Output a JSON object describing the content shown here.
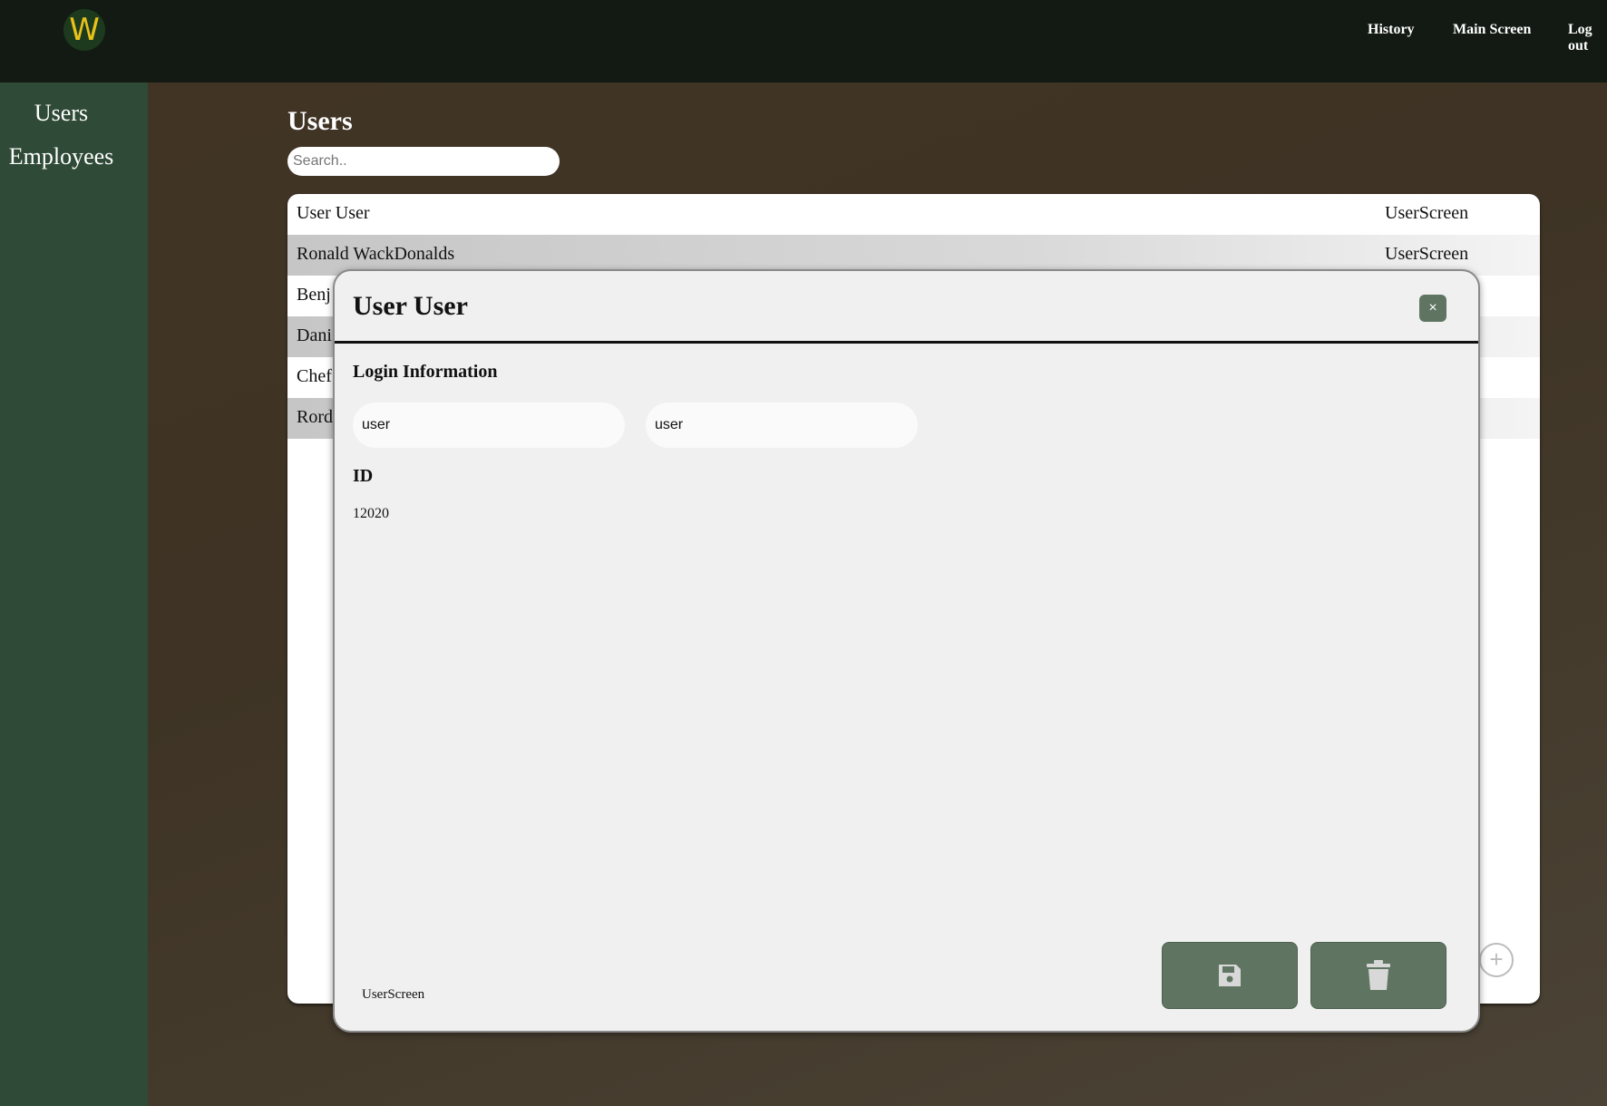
{
  "header": {
    "logo_letter": "W",
    "nav": [
      {
        "label": "History"
      },
      {
        "label": "Main Screen"
      },
      {
        "label": "Log out"
      }
    ]
  },
  "sidebar": {
    "items": [
      {
        "label": "Users"
      },
      {
        "label": "Employees"
      }
    ]
  },
  "main": {
    "title": "Users",
    "search_placeholder": "Search..",
    "rows": [
      {
        "name": "User User",
        "screen": "UserScreen"
      },
      {
        "name": "Ronald WackDonalds",
        "screen": "UserScreen"
      },
      {
        "name": "Benj",
        "screen": ""
      },
      {
        "name": "Dani",
        "screen": ""
      },
      {
        "name": "Chef",
        "screen": ""
      },
      {
        "name": "Rord",
        "screen": ""
      }
    ],
    "add_label": "+"
  },
  "modal": {
    "title": "User User",
    "close_label": "×",
    "login_section_label": "Login Information",
    "username_value": "user",
    "password_value": "user",
    "id_label": "ID",
    "id_value": "12020",
    "screen_label": "UserScreen",
    "save_icon": "floppy-disk-icon",
    "delete_icon": "trash-icon"
  },
  "colors": {
    "topbar": "#121a13",
    "sidebar": "#2f4a36",
    "accent_button": "#5f7561",
    "logo_letter": "#e8c21a"
  }
}
